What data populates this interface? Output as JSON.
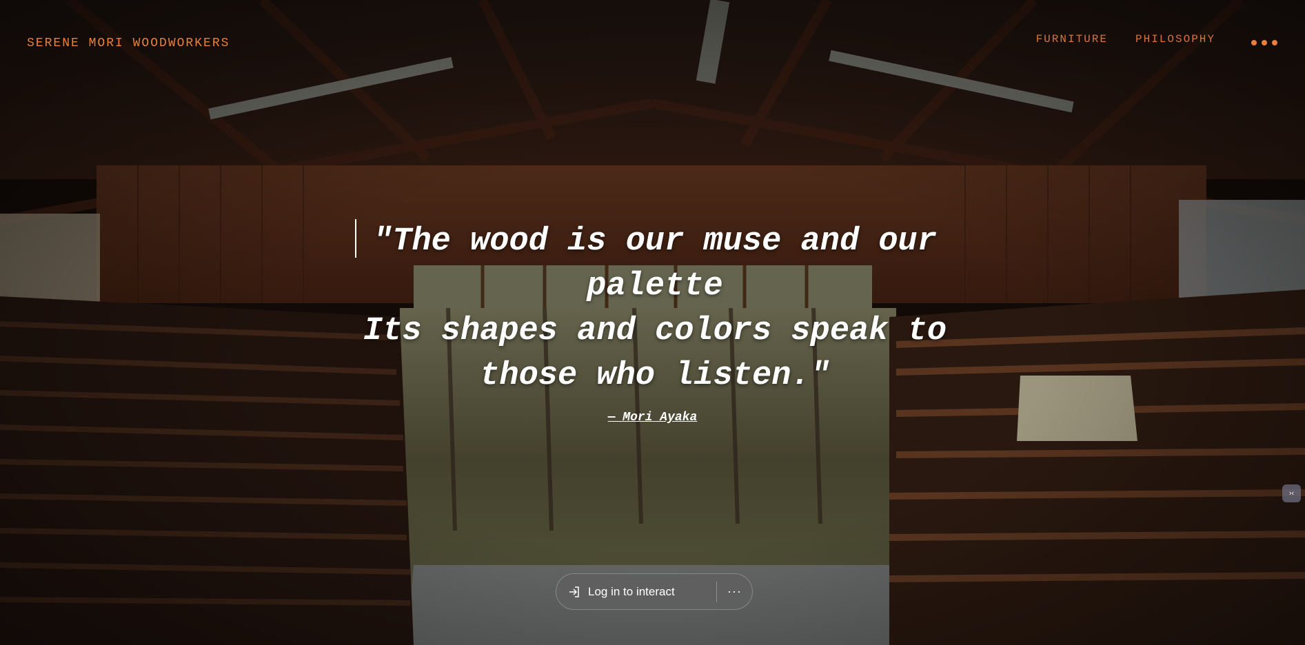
{
  "header": {
    "brand": "SERENE MORI WOODWORKERS",
    "nav": [
      "FURNITURE",
      "PHILOSOPHY"
    ]
  },
  "hero": {
    "quote_line1": "\"The wood is our muse and our palette",
    "quote_line2": "Its shapes and colors speak to those who listen.\"",
    "author": "— Mori Ayaka"
  },
  "login_bar": {
    "login_label": "Log in to interact",
    "more_label": "···"
  },
  "side_tab": {
    "label": "›‹"
  },
  "colors": {
    "accent": "#e8803a",
    "text": "#ffffff",
    "pill_bg": "#5f5f5f"
  },
  "icons": [
    "login-icon",
    "more-dots-icon",
    "menu-dots-icon",
    "collapse-icon"
  ]
}
